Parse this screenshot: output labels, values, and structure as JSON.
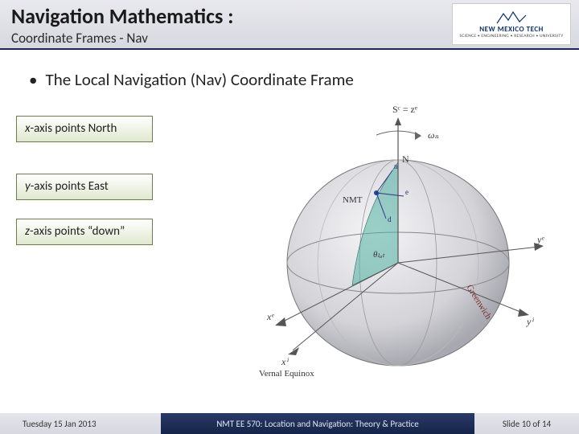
{
  "header": {
    "title": "Navigation Mathematics :",
    "subtitle": "Coordinate Frames - Nav"
  },
  "logo": {
    "name": "NEW MEXICO TECH",
    "tagline": "SCIENCE • ENGINEERING • RESEARCH • UNIVERSITY"
  },
  "bullet": "The Local Navigation (Nav) Coordinate Frame",
  "axis": {
    "x_prefix": "x",
    "x_text": "-axis points North",
    "y_prefix": "y",
    "y_text": "-axis points East",
    "z_prefix": "z",
    "z_text": "-axis points “down”"
  },
  "diagram": {
    "top_label": "Sᶜ = zᵉ",
    "omega": "ωₙ",
    "north": "N",
    "nmt": "NMT",
    "theta": "θₗₐₜ",
    "greenwich": "Greenwich",
    "xe": "xᵉ",
    "yi": "yⁱ",
    "ye": "yᵉ",
    "xi": "xⁱ",
    "vernal": "Vernal Equinox",
    "n_ax": "n",
    "e_ax": "e",
    "d_ax": "d"
  },
  "footer": {
    "date": "Tuesday 15 Jan 2013",
    "course": "NMT EE 570: Location and Navigation: Theory & Practice",
    "slide_prefix": "Slide",
    "slide_num": "10",
    "slide_of": "of",
    "slide_total": "14"
  }
}
